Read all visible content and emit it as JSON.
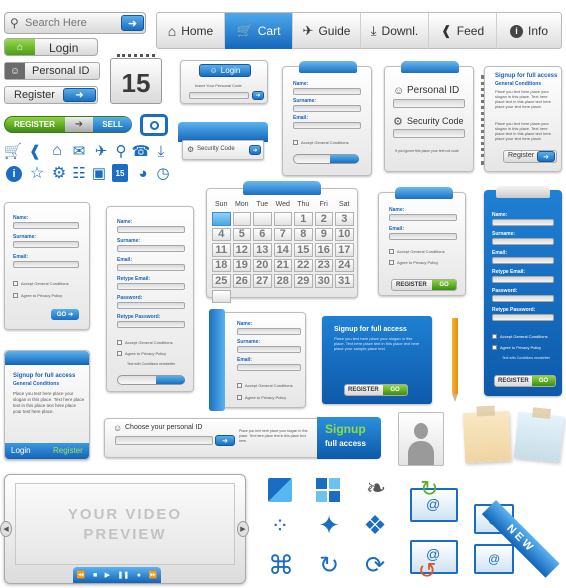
{
  "search": {
    "placeholder": "Search Here"
  },
  "login_button": "Login",
  "personal_id": "Personal ID",
  "register": "Register",
  "register_sell": {
    "left": "REGISTER",
    "right": "SELL"
  },
  "calendar_icon_day": "15",
  "nav": {
    "tabs": [
      "Home",
      "Cart",
      "Guide",
      "Downl.",
      "Feed",
      "Info"
    ],
    "active": "Cart"
  },
  "mini_login": {
    "title": "Login",
    "placeholder": "Insert Your Personal Code"
  },
  "security_code_widget": {
    "label": "Security Code"
  },
  "form_small": {
    "name": "Name:",
    "surname": "Surname:",
    "email": "Email:",
    "accept": "Accept General Conditions"
  },
  "id_panel": {
    "personal_id": "Personal ID",
    "security_code": "Security Code",
    "note": "If you ignore this place your text not code"
  },
  "signup_card": {
    "title": "Signup for full access",
    "subtitle": "General Conditions",
    "body": "Place you text here place your slogan in this place. Text here place text in this place text here place your text here place.",
    "body2": "Place you text here place your slogan in this place. Text here place text in this place text here place your text here place.",
    "button": "Register"
  },
  "reg_form_a": {
    "name": "Name:",
    "surname": "Surname:",
    "email": "Email:",
    "accept": "Accept General Conditions",
    "privacy": "Agree to Privacy Policy",
    "go": "GO"
  },
  "reg_form_b": {
    "name": "Name:",
    "surname": "Surname:",
    "email": "Email:",
    "retype_email": "Retype Email:",
    "password": "Password:",
    "retype_password": "Retype Password:",
    "accept": "Accept General Conditions",
    "privacy": "Agree to Privacy Policy",
    "note": "Text with Conditions newsletter"
  },
  "calendar": {
    "days": [
      "Sun",
      "Mon",
      "Tue",
      "Wed",
      "Thu",
      "Fri",
      "Sat"
    ],
    "dates": [
      "",
      "",
      "",
      "",
      "1",
      "2",
      "3",
      "4",
      "5",
      "6",
      "7",
      "8",
      "9",
      "10",
      "11",
      "12",
      "13",
      "14",
      "15",
      "16",
      "17",
      "18",
      "19",
      "20",
      "21",
      "22",
      "23",
      "24",
      "25",
      "26",
      "27",
      "28",
      "29",
      "30",
      "31",
      ""
    ],
    "highlight": "5"
  },
  "reg_form_c": {
    "name": "Name:",
    "email": "Email:",
    "accept": "Accept General Conditions",
    "privacy": "Agree to Privacy Policy",
    "register": "REGISTER",
    "go": "GO"
  },
  "reg_form_blue": {
    "name": "Name:",
    "surname": "Surname:",
    "email": "Email:",
    "retype_email": "Retype Email:",
    "password": "Password:",
    "retype_password": "Retype Password:",
    "accept": "Accept General Conditions",
    "privacy": "Agree to Privacy Policy",
    "note": "Text with Conditions newsletter",
    "register": "REGISTER",
    "go": "GO"
  },
  "reg_form_d": {
    "name": "Name:",
    "surname": "Surname:",
    "email": "Email:",
    "accept": "Accept General Conditions",
    "privacy": "Agree to Privacy Policy"
  },
  "blue_signup": {
    "title": "Signup for full access",
    "body": "Place you text here place your slogan in this place. Text here place text in this place text here place your sample place text.",
    "register": "REGISTER",
    "go": "GO"
  },
  "signup_card2": {
    "title": "Signup for full access",
    "subtitle": "General Conditions",
    "body": "Place you text here place your slogan in this place. Text here place text in this place text here place your text here place.",
    "login": "Login",
    "register": "Register"
  },
  "personal_id_bar": {
    "placeholder": "Choose your personal ID",
    "text": "Place you text here place your slogan in this place. Text here place text in this place text here.",
    "signup": "Signup",
    "full_access": "full access"
  },
  "video": {
    "line1": "YOUR VIDEO",
    "line2": "PREVIEW"
  },
  "ribbon": "NEW",
  "colors": {
    "accent": "#1a73c8",
    "green": "#6cc12b",
    "panel": "#e9e9e9"
  }
}
